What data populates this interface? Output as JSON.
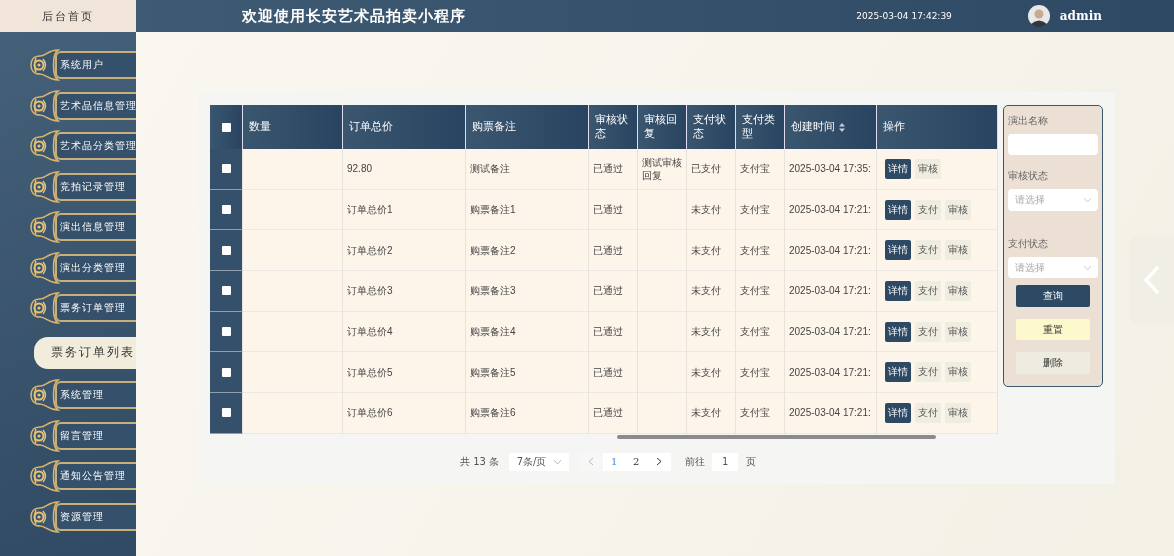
{
  "sidebar": {
    "home": "后台首页",
    "items": [
      {
        "label": "系统用户"
      },
      {
        "label": "艺术品信息管理"
      },
      {
        "label": "艺术品分类管理"
      },
      {
        "label": "竞拍记录管理"
      },
      {
        "label": "演出信息管理"
      },
      {
        "label": "演出分类管理"
      },
      {
        "label": "票务订单管理",
        "children": [
          {
            "label": "票务订单列表",
            "selected": true
          }
        ]
      },
      {
        "label": "系统管理"
      },
      {
        "label": "留言管理"
      },
      {
        "label": "通知公告管理"
      },
      {
        "label": "资源管理"
      }
    ]
  },
  "header": {
    "title": "欢迎使用长安艺术品拍卖小程序",
    "time": "2025-03-04 17:42:39",
    "user": "admin"
  },
  "table": {
    "all_checked": false,
    "columns": [
      "数量",
      "订单总价",
      "购票备注",
      "审核状态",
      "审核回复",
      "支付状态",
      "支付类型",
      "创建时间",
      "操作"
    ],
    "rows": [
      {
        "checked": false,
        "cells": [
          "",
          "92.80",
          "测试备注",
          "已通过",
          "测试审核回复",
          "已支付",
          "支付宝",
          "2025-03-04 17:35:"
        ],
        "actions": [
          {
            "label": "详情",
            "kind": "primary"
          },
          {
            "label": "审核",
            "kind": "plain"
          }
        ]
      },
      {
        "checked": false,
        "cells": [
          "",
          "订单总价1",
          "购票备注1",
          "已通过",
          "",
          "未支付",
          "支付宝",
          "2025-03-04 17:21:"
        ],
        "actions": [
          {
            "label": "详情",
            "kind": "primary"
          },
          {
            "label": "支付",
            "kind": "plain"
          },
          {
            "label": "审核",
            "kind": "plain"
          }
        ]
      },
      {
        "checked": false,
        "cells": [
          "",
          "订单总价2",
          "购票备注2",
          "已通过",
          "",
          "未支付",
          "支付宝",
          "2025-03-04 17:21:"
        ],
        "actions": [
          {
            "label": "详情",
            "kind": "primary"
          },
          {
            "label": "支付",
            "kind": "plain"
          },
          {
            "label": "审核",
            "kind": "plain"
          }
        ]
      },
      {
        "checked": false,
        "cells": [
          "",
          "订单总价3",
          "购票备注3",
          "已通过",
          "",
          "未支付",
          "支付宝",
          "2025-03-04 17:21:"
        ],
        "actions": [
          {
            "label": "详情",
            "kind": "primary"
          },
          {
            "label": "支付",
            "kind": "plain"
          },
          {
            "label": "审核",
            "kind": "plain"
          }
        ]
      },
      {
        "checked": false,
        "cells": [
          "",
          "订单总价4",
          "购票备注4",
          "已通过",
          "",
          "未支付",
          "支付宝",
          "2025-03-04 17:21:"
        ],
        "actions": [
          {
            "label": "详情",
            "kind": "primary"
          },
          {
            "label": "支付",
            "kind": "plain"
          },
          {
            "label": "审核",
            "kind": "plain"
          }
        ]
      },
      {
        "checked": false,
        "cells": [
          "",
          "订单总价5",
          "购票备注5",
          "已通过",
          "",
          "未支付",
          "支付宝",
          "2025-03-04 17:21:"
        ],
        "actions": [
          {
            "label": "详情",
            "kind": "primary"
          },
          {
            "label": "支付",
            "kind": "plain"
          },
          {
            "label": "审核",
            "kind": "plain"
          }
        ]
      },
      {
        "checked": false,
        "cells": [
          "",
          "订单总价6",
          "购票备注6",
          "已通过",
          "",
          "未支付",
          "支付宝",
          "2025-03-04 17:21:"
        ],
        "actions": [
          {
            "label": "详情",
            "kind": "primary"
          },
          {
            "label": "支付",
            "kind": "plain"
          },
          {
            "label": "审核",
            "kind": "plain"
          }
        ]
      }
    ]
  },
  "pagination": {
    "total": "共 13 条",
    "page_size": "7条/页",
    "pages": [
      {
        "label": "1",
        "selected": true
      },
      {
        "label": "2",
        "selected": false
      }
    ],
    "goto_label": "前往",
    "goto_value": "1",
    "goto_suffix": "页"
  },
  "filters": {
    "fields": [
      {
        "kind": "input",
        "label": "演出名称"
      },
      {
        "kind": "select",
        "label": "审核状态",
        "placeholder": "请选择"
      },
      {
        "kind": "select",
        "label": "支付状态",
        "placeholder": "请选择"
      }
    ],
    "buttons": [
      {
        "label": "查询",
        "kind": "primary"
      },
      {
        "label": "重置",
        "kind": "reset"
      },
      {
        "label": "删除",
        "kind": "delete"
      }
    ]
  }
}
